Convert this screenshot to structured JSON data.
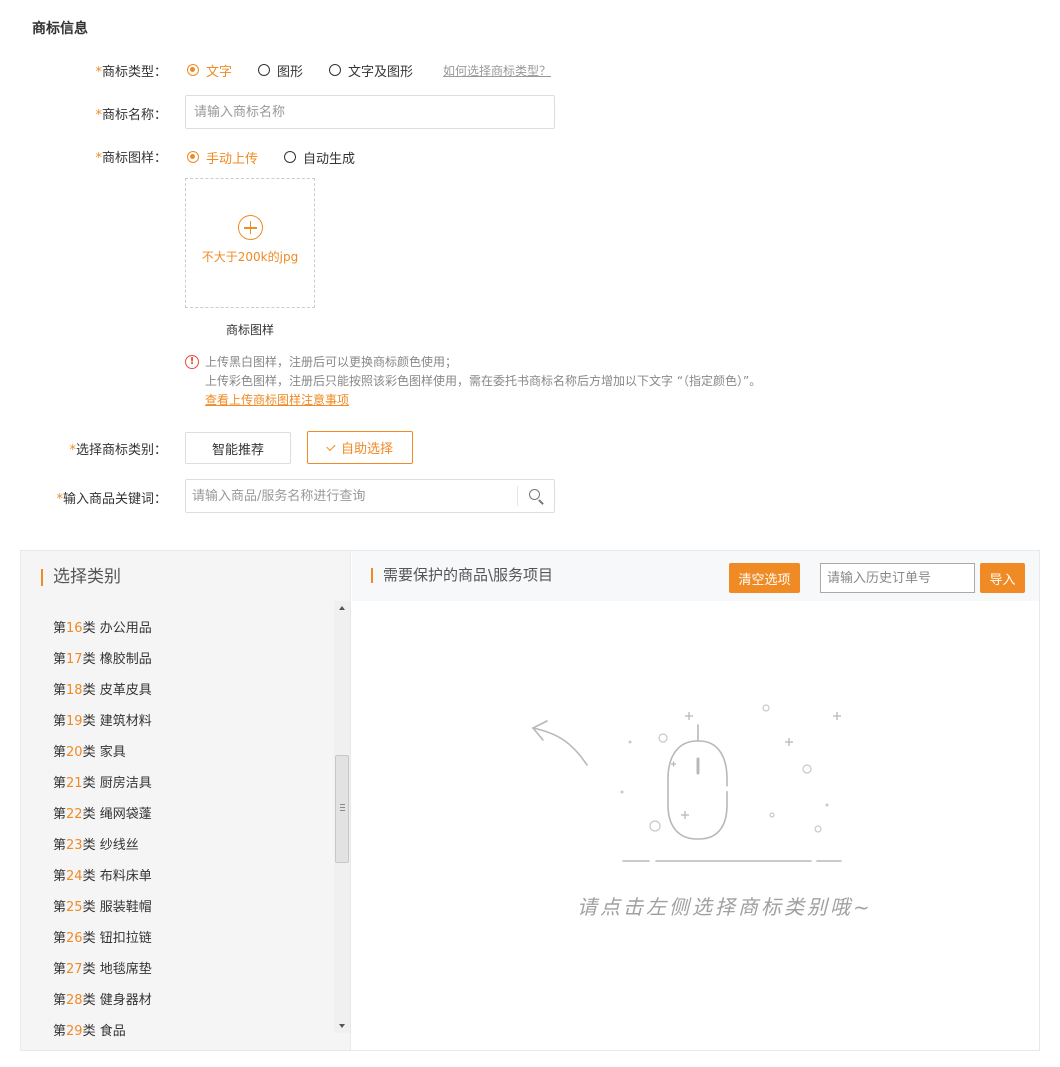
{
  "section": {
    "title": "商标信息"
  },
  "form": {
    "required_mark": "*",
    "type_label": "商标类型：",
    "type_options": [
      {
        "label": "文字",
        "checked": true
      },
      {
        "label": "图形",
        "checked": false
      },
      {
        "label": "文字及图形",
        "checked": false
      }
    ],
    "type_help": "如何选择商标类型？",
    "name_label": "商标名称：",
    "name_placeholder": "请输入商标名称",
    "sample_label": "商标图样：",
    "sample_options": [
      {
        "label": "手动上传",
        "checked": true
      },
      {
        "label": "自动生成",
        "checked": false
      }
    ],
    "upload_hint": "不大于200k的jpg",
    "upload_caption": "商标图样",
    "notice_icon": "!",
    "notice_line1": "上传黑白图样，注册后可以更换商标颜色使用；",
    "notice_line2": "上传彩色图样，注册后只能按照该彩色图样使用，需在委托书商标名称后方增加以下文字 “（指定颜色）”。",
    "notice_link": "查看上传商标图样注意事项",
    "category_label": "选择商标类别：",
    "btn_smart": "智能推荐",
    "btn_self": "自助选择",
    "keyword_label": "输入商品关键词：",
    "keyword_placeholder": "请输入商品/服务名称进行查询"
  },
  "left_panel": {
    "title": "选择类别",
    "categories": [
      {
        "prefix": "第",
        "num": "16",
        "suffix": "类",
        "name": "办公用品"
      },
      {
        "prefix": "第",
        "num": "17",
        "suffix": "类",
        "name": "橡胶制品"
      },
      {
        "prefix": "第",
        "num": "18",
        "suffix": "类",
        "name": "皮革皮具"
      },
      {
        "prefix": "第",
        "num": "19",
        "suffix": "类",
        "name": "建筑材料"
      },
      {
        "prefix": "第",
        "num": "20",
        "suffix": "类",
        "name": "家具"
      },
      {
        "prefix": "第",
        "num": "21",
        "suffix": "类",
        "name": "厨房洁具"
      },
      {
        "prefix": "第",
        "num": "22",
        "suffix": "类",
        "name": "绳网袋蓬"
      },
      {
        "prefix": "第",
        "num": "23",
        "suffix": "类",
        "name": "纱线丝"
      },
      {
        "prefix": "第",
        "num": "24",
        "suffix": "类",
        "name": "布料床单"
      },
      {
        "prefix": "第",
        "num": "25",
        "suffix": "类",
        "name": "服装鞋帽"
      },
      {
        "prefix": "第",
        "num": "26",
        "suffix": "类",
        "name": "钮扣拉链"
      },
      {
        "prefix": "第",
        "num": "27",
        "suffix": "类",
        "name": "地毯席垫"
      },
      {
        "prefix": "第",
        "num": "28",
        "suffix": "类",
        "name": "健身器材"
      },
      {
        "prefix": "第",
        "num": "29",
        "suffix": "类",
        "name": "食品"
      }
    ]
  },
  "right_panel": {
    "title": "需要保护的商品\\服务项目",
    "clear_label": "清空选项",
    "order_placeholder": "请输入历史订单号",
    "import_label": "导入",
    "empty_text": "请点击左侧选择商标类别哦~"
  },
  "colors": {
    "accent": "#f08a24",
    "text": "#333333",
    "muted": "#999999",
    "panel_bg": "#f5f5f5"
  }
}
